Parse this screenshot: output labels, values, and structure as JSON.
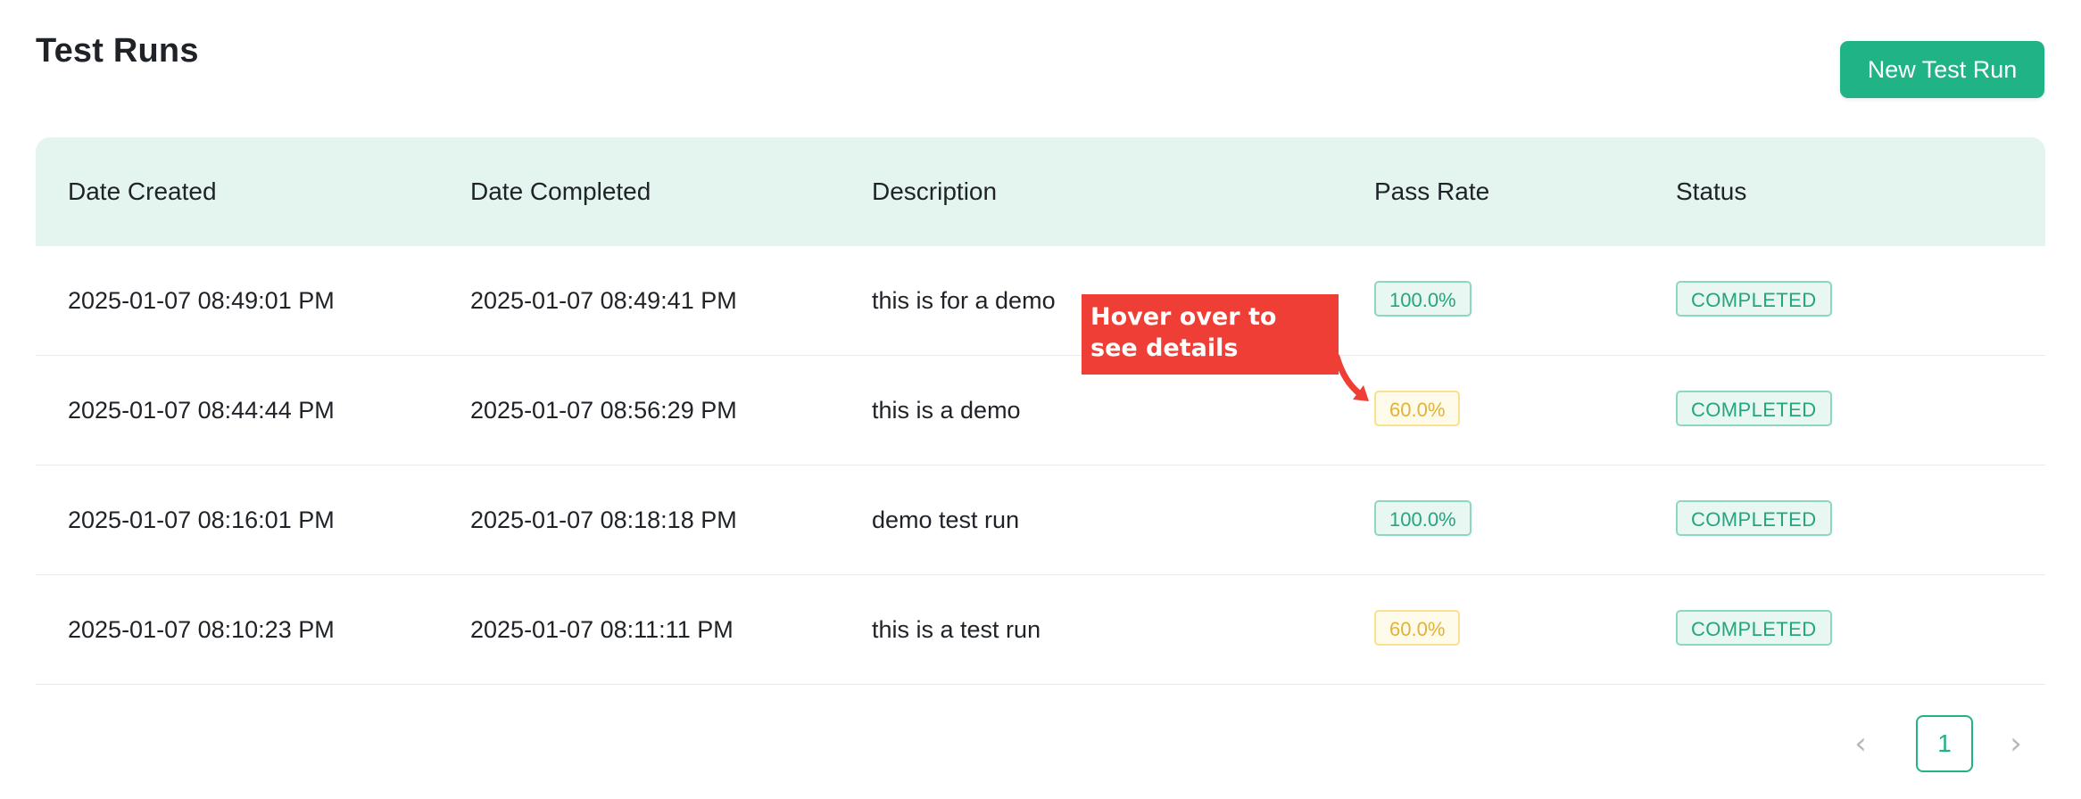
{
  "page": {
    "title": "Test Runs",
    "new_button_label": "New Test Run"
  },
  "table": {
    "headers": [
      "Date Created",
      "Date Completed",
      "Description",
      "Pass Rate",
      "Status"
    ],
    "rows": [
      {
        "date_created": "2025-01-07 08:49:01 PM",
        "date_completed": "2025-01-07 08:49:41 PM",
        "description": "this is for a demo",
        "pass_rate": "100.0%",
        "status": "COMPLETED"
      },
      {
        "date_created": "2025-01-07 08:44:44 PM",
        "date_completed": "2025-01-07 08:56:29 PM",
        "description": "this is a demo",
        "pass_rate": "60.0%",
        "status": "COMPLETED"
      },
      {
        "date_created": "2025-01-07 08:16:01 PM",
        "date_completed": "2025-01-07 08:18:18 PM",
        "description": "demo test run",
        "pass_rate": "100.0%",
        "status": "COMPLETED"
      },
      {
        "date_created": "2025-01-07 08:10:23 PM",
        "date_completed": "2025-01-07 08:11:11 PM",
        "description": "this is a test run",
        "pass_rate": "60.0%",
        "status": "COMPLETED"
      }
    ]
  },
  "callout": {
    "text": "Hover over to see details"
  },
  "pagination": {
    "prev_icon": "‹",
    "current_page": "1",
    "next_icon": "›"
  },
  "colors": {
    "accent": "#1fb386",
    "header_bg": "#e4f4ee",
    "pass_full": "#23a57e",
    "pass_partial": "#e2b235",
    "callout_bg": "#ef3e36"
  }
}
